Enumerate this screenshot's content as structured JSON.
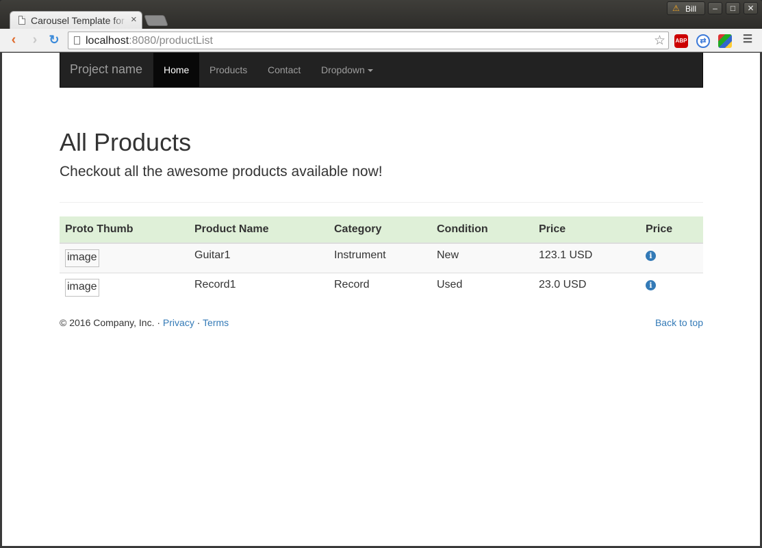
{
  "browser": {
    "tab_title": "Carousel Template for Bootstrap",
    "tab_close": "×",
    "profile_name": "Bill",
    "profile_warning": "⚠",
    "url_host": "localhost",
    "url_rest": ":8080/productList",
    "extensions": [
      "ABP",
      "sync",
      "ext"
    ]
  },
  "navbar": {
    "brand": "Project name",
    "links": [
      "Home",
      "Products",
      "Contact",
      "Dropdown"
    ],
    "active_index": 0
  },
  "jumbotron": {
    "title": "All Products",
    "lead": "Checkout all the awesome products available now!"
  },
  "table": {
    "headers": [
      "Proto Thumb",
      "Product Name",
      "Category",
      "Condition",
      "Price",
      "Price"
    ],
    "rows": [
      {
        "thumb_alt": "image",
        "name": "Guitar1",
        "category": "Instrument",
        "condition": "New",
        "price": "123.1 USD",
        "info_icon": "info-circle-icon"
      },
      {
        "thumb_alt": "image",
        "name": "Record1",
        "category": "Record",
        "condition": "Used",
        "price": "23.0 USD",
        "info_icon": "info-circle-icon"
      }
    ],
    "header_bg": "#dff0d8"
  },
  "footer": {
    "copyright": "© 2016 Company, Inc.",
    "sep": "·",
    "privacy": "Privacy",
    "terms": "Terms",
    "back_to_top": "Back to top"
  },
  "colors": {
    "link": "#337ab7",
    "navbar_bg": "#222222",
    "navbar_text": "#9d9d9d"
  }
}
